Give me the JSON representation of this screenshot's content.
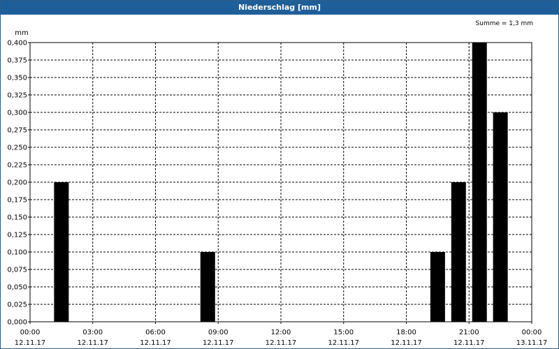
{
  "window": {
    "title": "Niederschlag [mm]"
  },
  "summary": "Summe = 1,3 mm",
  "colors": {
    "titlebar": "#1f5f99",
    "bar": "#000000",
    "grid": "#000000"
  },
  "chart_data": {
    "type": "bar",
    "title": "Niederschlag [mm]",
    "ylabel": "mm",
    "xlabel": "",
    "ylim": [
      0,
      0.4
    ],
    "xlim": [
      "2017-11-12 00:00",
      "2017-11-13 00:00"
    ],
    "grid": true,
    "y_ticks": [
      "0,000",
      "0,025",
      "0,050",
      "0,075",
      "0,100",
      "0,125",
      "0,150",
      "0,175",
      "0,200",
      "0,225",
      "0,250",
      "0,275",
      "0,300",
      "0,325",
      "0,350",
      "0,375",
      "0,400"
    ],
    "x_ticks": [
      {
        "time": "00:00",
        "date": "12.11.17"
      },
      {
        "time": "03:00",
        "date": "12.11.17"
      },
      {
        "time": "06:00",
        "date": "12.11.17"
      },
      {
        "time": "09:00",
        "date": "12.11.17"
      },
      {
        "time": "12:00",
        "date": "12.11.17"
      },
      {
        "time": "15:00",
        "date": "12.11.17"
      },
      {
        "time": "18:00",
        "date": "12.11.17"
      },
      {
        "time": "21:00",
        "date": "12.11.17"
      },
      {
        "time": "00:00",
        "date": "13.11.17"
      }
    ],
    "bars": [
      {
        "x": "2017-11-12 01:30",
        "value": 0.2
      },
      {
        "x": "2017-11-12 08:30",
        "value": 0.1
      },
      {
        "x": "2017-11-12 19:30",
        "value": 0.1
      },
      {
        "x": "2017-11-12 20:30",
        "value": 0.2
      },
      {
        "x": "2017-11-12 21:30",
        "value": 0.4
      },
      {
        "x": "2017-11-12 22:30",
        "value": 0.3
      }
    ]
  }
}
